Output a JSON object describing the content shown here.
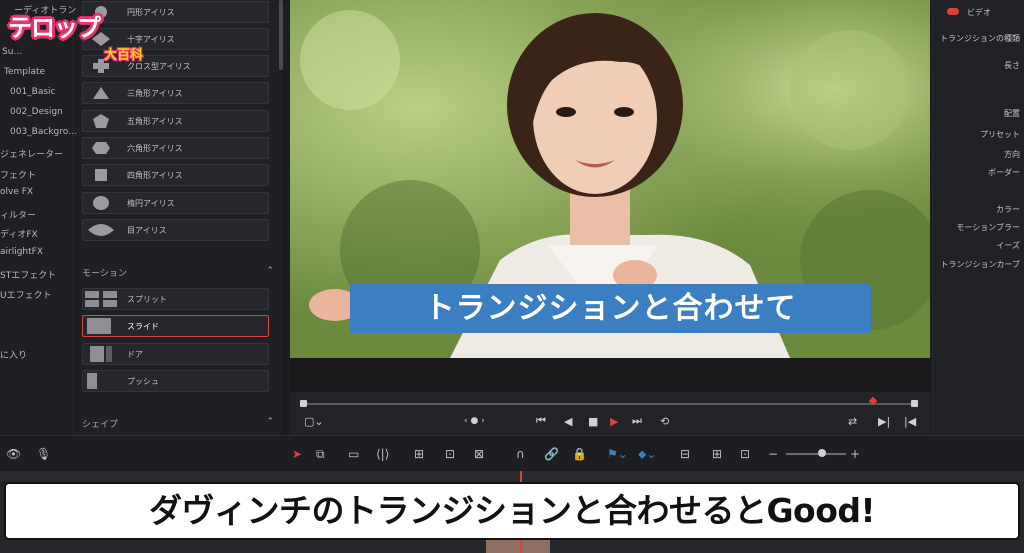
{
  "bins": {
    "items": [
      {
        "label": "ーディオトラン…"
      },
      {
        "label": "Su…"
      },
      {
        "label": "Template"
      },
      {
        "label": "001_Basic"
      },
      {
        "label": "002_Design"
      },
      {
        "label": "003_Backgro…"
      },
      {
        "label": "ジェネレーター"
      },
      {
        "label": "フェクト"
      },
      {
        "label": "olve FX"
      },
      {
        "label": "ィルター"
      },
      {
        "label": "ディオFX"
      },
      {
        "label": "airlightFX"
      },
      {
        "label": "STエフェクト"
      },
      {
        "label": "Uエフェクト"
      },
      {
        "label": "に入り"
      }
    ]
  },
  "effects": {
    "iris_items": [
      {
        "label": "円形アイリス",
        "icon": "circle-shape"
      },
      {
        "label": "十字アイリス",
        "icon": "cross-shape"
      },
      {
        "label": "クロス型アイリス",
        "icon": "plus-shape"
      },
      {
        "label": "三角形アイリス",
        "icon": "triangle-shape"
      },
      {
        "label": "五角形アイリス",
        "icon": "pentagon-shape"
      },
      {
        "label": "六角形アイリス",
        "icon": "hexagon-shape"
      },
      {
        "label": "四角形アイリス",
        "icon": "square-shape"
      },
      {
        "label": "楕円アイリス",
        "icon": "ellipse-shape"
      },
      {
        "label": "目アイリス",
        "icon": "eye-shape"
      }
    ],
    "motion_header": "モーション",
    "motion_items": [
      {
        "label": "スプリット",
        "icon": "split-shape"
      },
      {
        "label": "スライド",
        "icon": "slide-shape",
        "selected": true
      },
      {
        "label": "ドア",
        "icon": "door-shape"
      },
      {
        "label": "プッシュ",
        "icon": "push-shape"
      }
    ],
    "shape_header": "シェイプ"
  },
  "viewer": {
    "telop": "トランジションと合わせて"
  },
  "inspector": {
    "video_tab": "ビデオ",
    "rows": [
      "トランジションの種類",
      "長さ",
      "配置",
      "プリセット",
      "方向",
      "ボーダー",
      "カラー",
      "モーションブラー",
      "イーズ",
      "トランジションカーブ"
    ]
  },
  "logo": {
    "main": "テロップ",
    "sub": "大百科"
  },
  "caption": {
    "text": "ダヴィンチのトランジションと合わせるとGood!"
  },
  "colors": {
    "accent": "#e0403a",
    "telop_bg": "#3b7ec2",
    "logo_pink": "#e8336d",
    "logo_yellow": "#ffd21f"
  }
}
